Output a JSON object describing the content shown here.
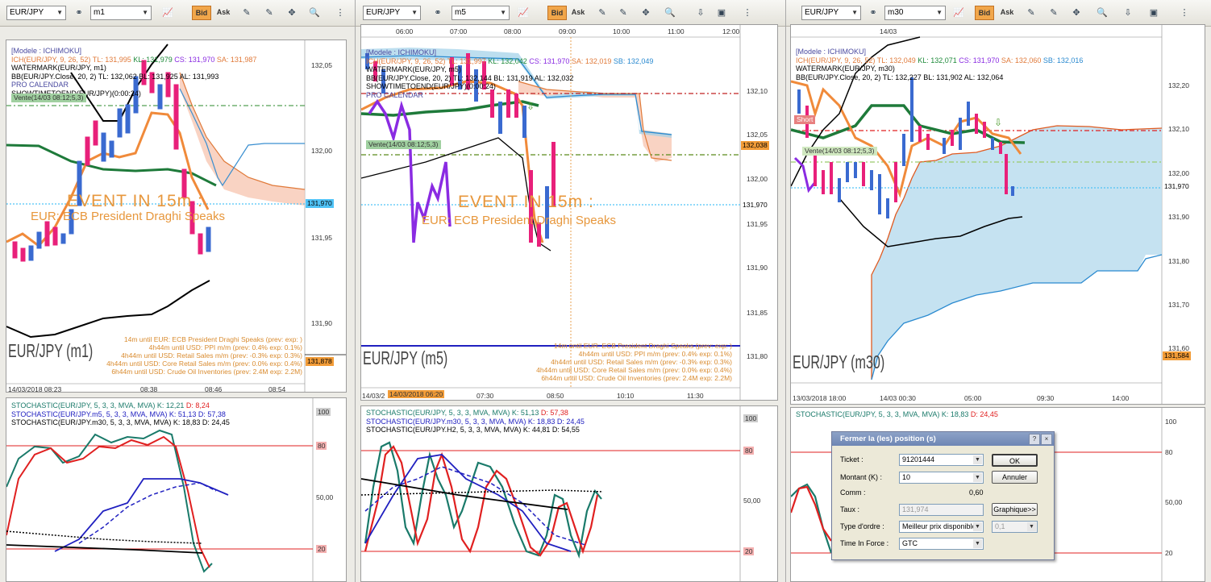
{
  "panels": [
    {
      "symbol": "EUR/JPY",
      "timeframe": "m1",
      "bid": "Bid",
      "ask": "Ask",
      "legend": [
        {
          "text": "[Modele : ICHIMOKU]",
          "color": "#4a4aa0"
        },
        {
          "parts": [
            {
              "text": "ICH(EUR/JPY, 9, 26, 52)  TL: 131,995",
              "color": "#e07a3a"
            },
            {
              "text": "  KL: 131,979",
              "color": "#1e8a3a"
            },
            {
              "text": "  CS: 131,970",
              "color": "#8a2be2"
            },
            {
              "text": "  SA: 131,987",
              "color": "#e07a3a"
            }
          ]
        },
        {
          "text": "WATERMARK(EUR/JPY, m1)",
          "color": "#000"
        },
        {
          "text": "BB(EUR/JPY.Close, 20, 2)  TL: 132,062  BL: 131,925  AL: 131,993",
          "color": "#000"
        },
        {
          "text": "PRO CALENDAR",
          "color": "#4a4aa0"
        },
        {
          "text": "SHOWTIMETOEND(EUR/JPY)(0:00:24)",
          "color": "#000"
        }
      ],
      "yaxis": [
        "132,05",
        "132,00",
        "131,95",
        "131,90"
      ],
      "price_tags": [
        {
          "text": "131,970",
          "bg": "#4fc3f7",
          "fg": "#000"
        },
        {
          "text": "131,878",
          "bg": "#f29c38",
          "fg": "#000"
        }
      ],
      "event": {
        "title": "EVENT IN 15m :",
        "sub": "EUR: ECB President Draghi Speaks"
      },
      "signal": "Vente(14/03 08:12;5,3)",
      "watermark": "EUR/JPY (m1)",
      "news": [
        "14m until EUR: ECB President Draghi Speaks (prev:  exp: )",
        "4h44m until USD: PPI m/m (prev: 0.4% exp: 0.1%)",
        "4h44m until USD: Retail Sales m/m (prev: -0.3% exp: 0.3%)",
        "4h44m until USD: Core Retail Sales m/m (prev: 0.0% exp: 0.4%)",
        "6h44m until USD: Crude Oil Inventories (prev: 2.4M exp: 2.2M)"
      ],
      "xaxis": [
        "14/03/2018 08:23",
        "08:38",
        "08:46",
        "08:54"
      ],
      "stoch_legend": [
        {
          "parts": [
            {
              "text": "STOCHASTIC(EUR/JPY, 5, 3, 3, MVA, MVA)  K: 12,21",
              "color": "#1a7a6a"
            },
            {
              "text": "  D: 8,24",
              "color": "#e02020"
            }
          ]
        },
        {
          "parts": [
            {
              "text": "STOCHASTIC(EUR/JPY.m5, 5, 3, 3, MVA, MVA)  K: 51,13  D: 57,38",
              "color": "#2020c0"
            }
          ]
        },
        {
          "parts": [
            {
              "text": "STOCHASTIC(EUR/JPY.m30, 5, 3, 3, MVA, MVA)  K: 18,83  D: 24,45",
              "color": "#000"
            }
          ]
        }
      ],
      "stoch_axis": [
        "100",
        "80",
        "50,00",
        "20"
      ]
    },
    {
      "symbol": "EUR/JPY",
      "timeframe": "m5",
      "bid": "Bid",
      "ask": "Ask",
      "top_times": [
        "06:00",
        "07:00",
        "08:00",
        "09:00",
        "10:00",
        "11:00",
        "12:00"
      ],
      "legend": [
        {
          "text": "[Modele : ICHIMOKU]",
          "color": "#4a4aa0"
        },
        {
          "parts": [
            {
              "text": "ICH(EUR/JPY, 9, 26, 52)  TL: 131,997",
              "color": "#e07a3a"
            },
            {
              "text": "  KL: 132,042",
              "color": "#1e8a3a"
            },
            {
              "text": "  CS: 131,970",
              "color": "#8a2be2"
            },
            {
              "text": "  SA: 132,019",
              "color": "#e07a3a"
            },
            {
              "text": "  SB: 132,049",
              "color": "#2a8ad0"
            }
          ]
        },
        {
          "text": "WATERMARK(EUR/JPY, m5)",
          "color": "#000"
        },
        {
          "text": "BB(EUR/JPY.Close, 20, 2)  TL: 132,144  BL: 131,919  AL: 132,032",
          "color": "#000"
        },
        {
          "text": "SHOWTIMETOEND(EUR/JPY)(0:00:24)",
          "color": "#000"
        },
        {
          "text": "PRO CALENDAR",
          "color": "#4a4aa0"
        }
      ],
      "yaxis": [
        "132,10",
        "132,05",
        "132,00",
        "131,95",
        "131,90",
        "131,85",
        "131,80"
      ],
      "price_tags": [
        {
          "text": "132,038",
          "bg": "#f29c38",
          "fg": "#000"
        },
        {
          "text": "131,970",
          "bg": "#ffffff",
          "fg": "#000"
        }
      ],
      "event": {
        "title": "EVENT IN 15m :",
        "sub": "EUR: ECB President Draghi Speaks"
      },
      "signal": "Vente(14/03 08:12;5,3)",
      "watermark": "EUR/JPY (m5)",
      "news": [
        "14m until EUR: ECB President Draghi Speaks (prev:  exp: )",
        "4h44m until USD: PPI m/m (prev: 0.4% exp: 0.1%)",
        "4h44m until USD: Retail Sales m/m (prev: -0.3% exp: 0.3%)",
        "4h44m until USD: Core Retail Sales m/m (prev: 0.0% exp: 0.4%)",
        "6h44m until USD: Crude Oil Inventories (prev: 2.4M exp: 2.2M)"
      ],
      "xaxis": [
        "14/03/2",
        "14/03/2018 06:20",
        "07:30",
        "08:50",
        "10:10",
        "11:30"
      ],
      "stoch_legend": [
        {
          "parts": [
            {
              "text": "STOCHASTIC(EUR/JPY, 5, 3, 3, MVA, MVA)  K: 51,13",
              "color": "#1a7a6a"
            },
            {
              "text": "  D: 57,38",
              "color": "#e02020"
            }
          ]
        },
        {
          "parts": [
            {
              "text": "STOCHASTIC(EUR/JPY.m30, 5, 3, 3, MVA, MVA)  K: 18,83  D: 24,45",
              "color": "#2020c0"
            }
          ]
        },
        {
          "parts": [
            {
              "text": "STOCHASTIC(EUR/JPY.H2, 5, 3, 3, MVA, MVA)  K: 44,81  D: 54,55",
              "color": "#000"
            }
          ]
        }
      ],
      "stoch_axis": [
        "100",
        "80",
        "50,00",
        "20"
      ]
    },
    {
      "symbol": "EUR/JPY",
      "timeframe": "m30",
      "bid": "Bid",
      "ask": "Ask",
      "top_times": [
        "14/03"
      ],
      "legend": [
        {
          "text": "[Modele : ICHIMOKU]",
          "color": "#4a4aa0"
        },
        {
          "parts": [
            {
              "text": "ICH(EUR/JPY, 9, 26, 52)  TL: 132,049",
              "color": "#e07a3a"
            },
            {
              "text": "  KL: 132,071",
              "color": "#1e8a3a"
            },
            {
              "text": "  CS: 131,970",
              "color": "#8a2be2"
            },
            {
              "text": "  SA: 132,060",
              "color": "#e07a3a"
            },
            {
              "text": "  SB: 132,016",
              "color": "#2a8ad0"
            }
          ]
        },
        {
          "text": "WATERMARK(EUR/JPY, m30)",
          "color": "#000"
        },
        {
          "text": "BB(EUR/JPY.Close, 20, 2)  TL: 132,227  BL: 131,902  AL: 132,064",
          "color": "#000"
        }
      ],
      "yaxis": [
        "132,20",
        "132,10",
        "132,00",
        "131,90",
        "131,80",
        "131,70",
        "131,60"
      ],
      "price_tags": [
        {
          "text": "131,970",
          "bg": "#ffffff",
          "fg": "#000"
        },
        {
          "text": "131,584",
          "bg": "#f29c38",
          "fg": "#000"
        }
      ],
      "signal": "Vente(14/03 08:12;5,3)",
      "watermark": "EUR/JPY (m30)",
      "xaxis": [
        "13/03/2018 18:00",
        "14/03 00:30",
        "05:00",
        "09:30",
        "14:00"
      ],
      "stoch_legend": [
        {
          "parts": [
            {
              "text": "STOCHASTIC(EUR/JPY, 5, 3, 3, MVA, MVA)  K: 18,83",
              "color": "#1a7a6a"
            },
            {
              "text": "  D: 24,45",
              "color": "#e02020"
            }
          ]
        }
      ],
      "stoch_axis": [
        "100",
        "80",
        "50,00",
        "20"
      ]
    }
  ],
  "dialog": {
    "title": "Fermer la (les) position (s)",
    "help": "?",
    "close": "×",
    "fields": [
      {
        "label": "Ticket :",
        "value": "91201444",
        "type": "select"
      },
      {
        "label": "Montant (K) :",
        "value": "10",
        "type": "select"
      },
      {
        "label": "Comm :",
        "value": "0,60",
        "type": "text"
      },
      {
        "label": "Taux :",
        "value": "131,974",
        "type": "disabled"
      },
      {
        "label": "Type d'ordre :",
        "value": "Meilleur prix disponible",
        "type": "select"
      },
      {
        "label": "Time In Force :",
        "value": "GTC",
        "type": "select"
      }
    ],
    "rate_step": "0,1",
    "ok": "OK",
    "cancel": "Annuler",
    "graph": "Graphique>>"
  }
}
